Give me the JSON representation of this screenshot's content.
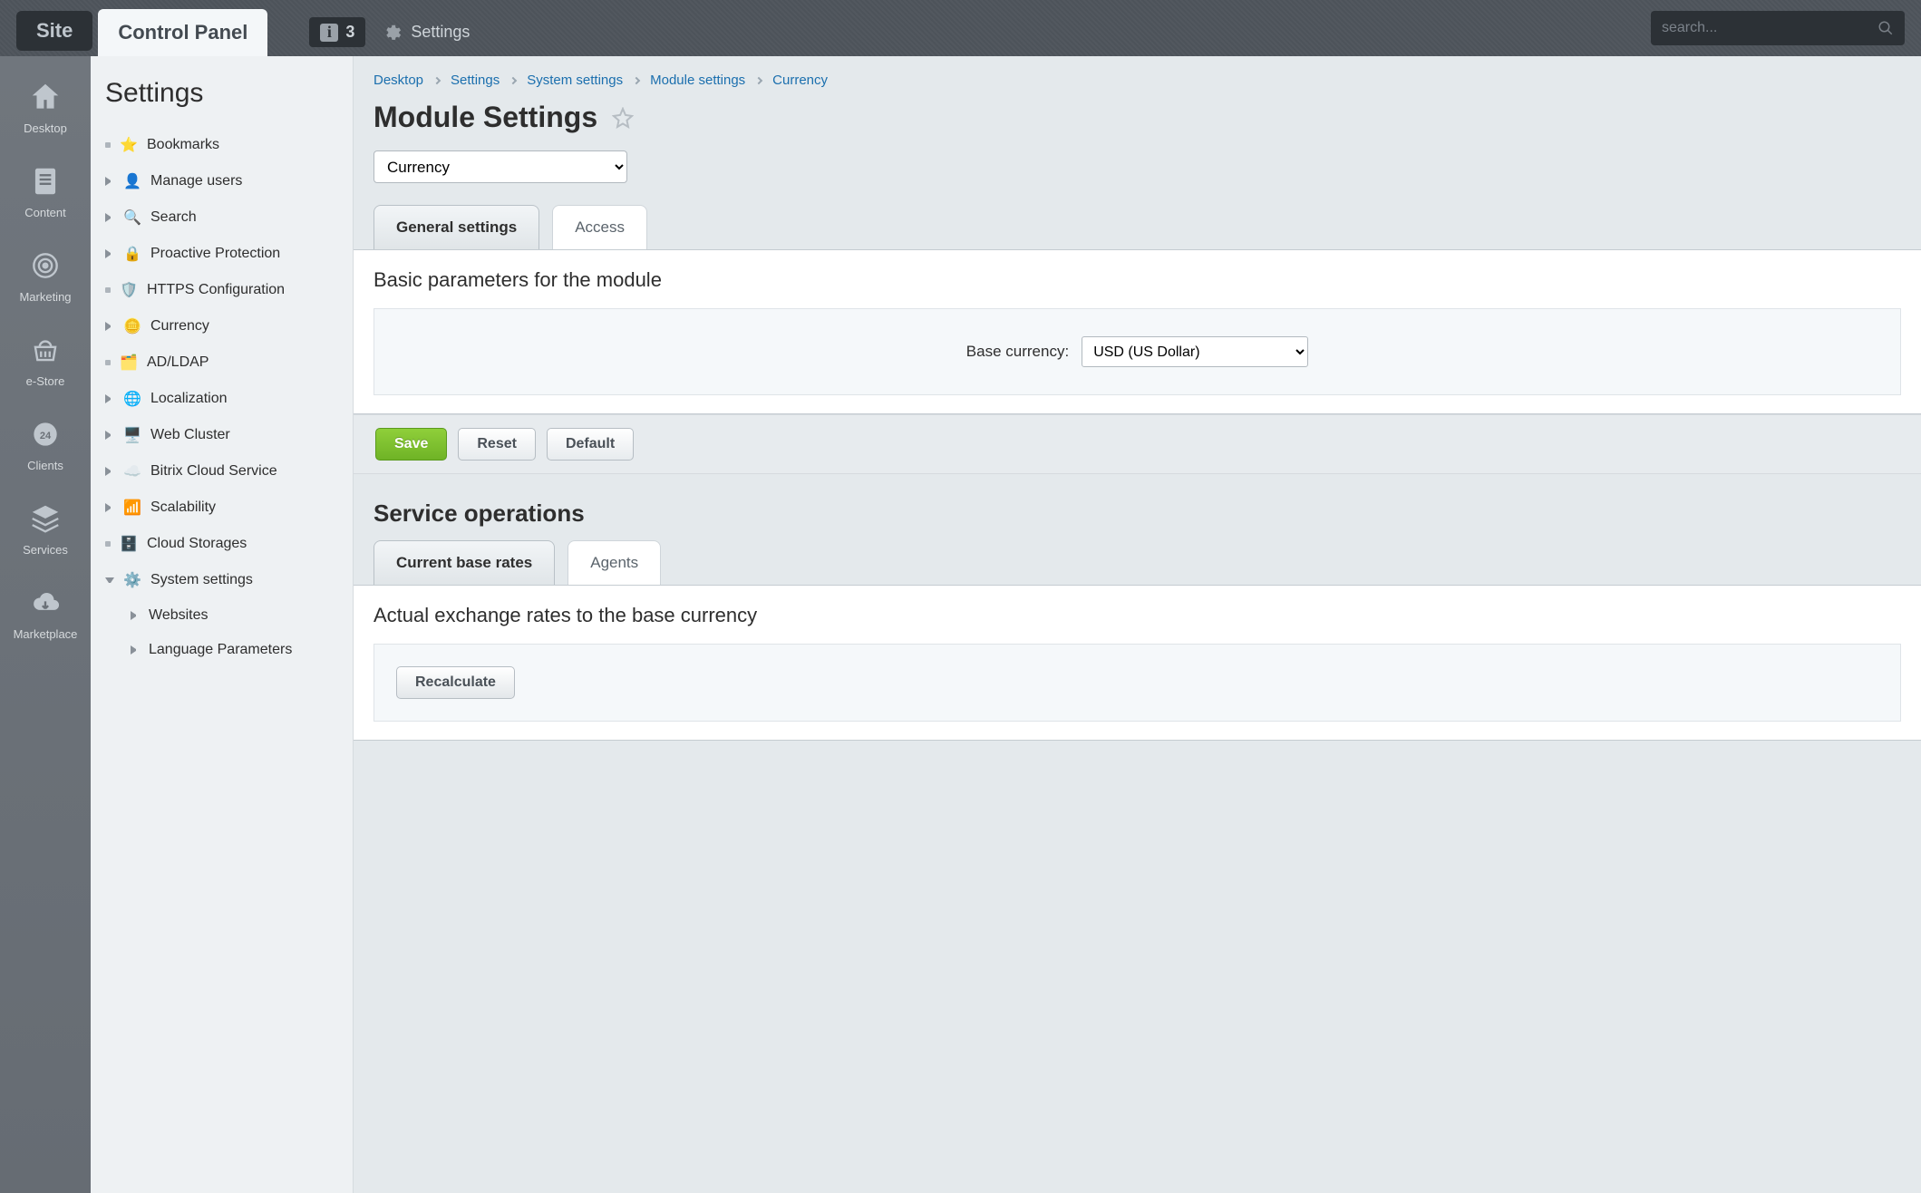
{
  "header": {
    "siteTab": "Site",
    "cpTab": "Control Panel",
    "notifCount": "3",
    "settingsLabel": "Settings",
    "searchPlaceholder": "search..."
  },
  "rail": {
    "items": [
      {
        "label": "Desktop"
      },
      {
        "label": "Content"
      },
      {
        "label": "Marketing"
      },
      {
        "label": "e-Store"
      },
      {
        "label": "Clients"
      },
      {
        "label": "Services"
      },
      {
        "label": "Marketplace"
      }
    ]
  },
  "sidebar": {
    "title": "Settings",
    "items": [
      {
        "label": "Bookmarks",
        "arrow": "dot"
      },
      {
        "label": "Manage users",
        "arrow": "collapsed"
      },
      {
        "label": "Search",
        "arrow": "collapsed"
      },
      {
        "label": "Proactive Protection",
        "arrow": "collapsed"
      },
      {
        "label": "HTTPS Configuration",
        "arrow": "dot"
      },
      {
        "label": "Currency",
        "arrow": "collapsed"
      },
      {
        "label": "AD/LDAP",
        "arrow": "dot"
      },
      {
        "label": "Localization",
        "arrow": "collapsed"
      },
      {
        "label": "Web Cluster",
        "arrow": "collapsed"
      },
      {
        "label": "Bitrix Cloud Service",
        "arrow": "collapsed"
      },
      {
        "label": "Scalability",
        "arrow": "collapsed"
      },
      {
        "label": "Cloud Storages",
        "arrow": "dot"
      },
      {
        "label": "System settings",
        "arrow": "expanded"
      }
    ],
    "subitems": [
      {
        "label": "Websites"
      },
      {
        "label": "Language Parameters"
      }
    ]
  },
  "breadcrumbs": [
    "Desktop",
    "Settings",
    "System settings",
    "Module settings",
    "Currency"
  ],
  "page": {
    "title": "Module Settings",
    "moduleSelected": "Currency",
    "tabs1": [
      "General settings",
      "Access"
    ],
    "card1": {
      "heading": "Basic parameters for the module",
      "fieldLabel": "Base currency:",
      "fieldValue": "USD (US Dollar)"
    },
    "buttons": {
      "save": "Save",
      "reset": "Reset",
      "default": "Default"
    },
    "section2Title": "Service operations",
    "tabs2": [
      "Current base rates",
      "Agents"
    ],
    "card2": {
      "heading": "Actual exchange rates to the base currency",
      "recalc": "Recalculate"
    }
  }
}
